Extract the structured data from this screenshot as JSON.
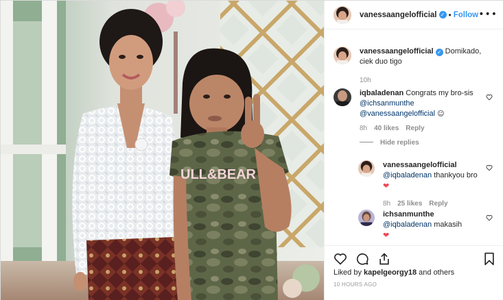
{
  "post": {
    "photo_shirt_text": "ULL&BEAR",
    "author": "vanessaangelofficial",
    "follow_label": "Follow",
    "more_icon": "more-options-icon",
    "verified_icon": "verified-badge-icon"
  },
  "caption": {
    "user": "vanessaangelofficial",
    "text": "Domikado, ciek duo tigo",
    "time": "10h"
  },
  "comments": [
    {
      "user": "iqbaladenan",
      "text": "Congrats my bro-sis",
      "mention1": "@ichsanmunthe",
      "mention2": "@vanessaangelofficial",
      "emoji": "☺",
      "time": "8h",
      "likes": "40 likes",
      "reply_label": "Reply",
      "hide_replies_label": "Hide replies"
    }
  ],
  "replies": [
    {
      "user": "vanessaangelofficial",
      "mention": "@iqbaladenan",
      "text": "thankyou bro",
      "emoji": "❤",
      "time": "8h",
      "likes": "25 likes",
      "reply_label": "Reply"
    },
    {
      "user": "ichsanmunthe",
      "mention": "@iqbaladenan",
      "text": "makasih",
      "emoji": "❤"
    }
  ],
  "footer": {
    "liked_prefix": "Liked by",
    "liked_user": "kapelgeorgy18",
    "liked_suffix": "and others",
    "time_ago": "10 HOURS AGO"
  },
  "colors": {
    "link_blue": "#3897f0",
    "mention_blue": "#003569",
    "meta_gray": "#8e8e8e",
    "heart_red": "#ed4956"
  }
}
